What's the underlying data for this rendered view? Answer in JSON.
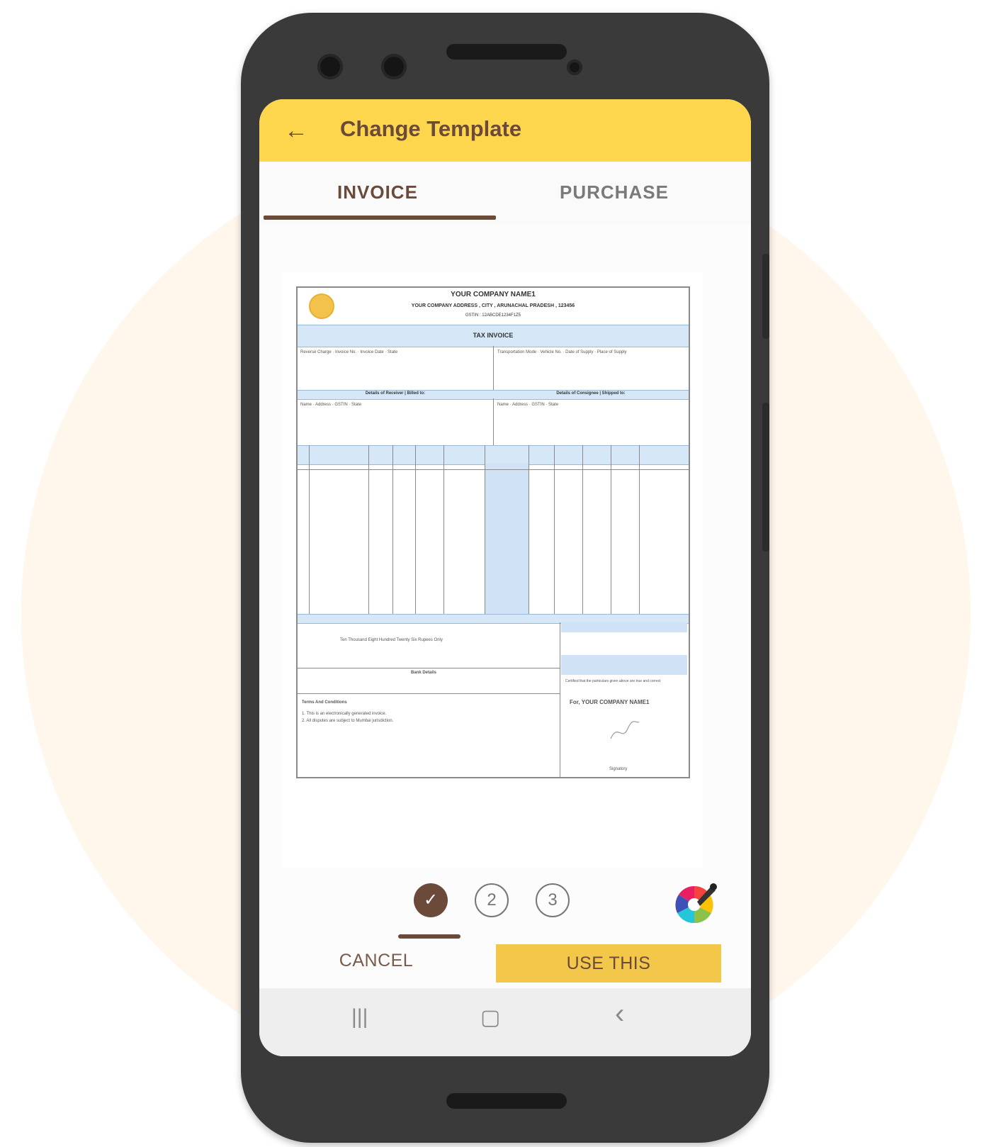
{
  "appbar": {
    "title": "Change Template",
    "back_icon": "arrow-left-icon"
  },
  "tabs": [
    {
      "label": "INVOICE",
      "selected": true
    },
    {
      "label": "PURCHASE",
      "selected": false
    }
  ],
  "template_preview": {
    "company_name": "YOUR COMPANY NAME1",
    "company_address": "YOUR COMPANY ADDRESS , CITY , ARUNACHAL PRADESH , 123456",
    "gstin": "GSTIN : 12ABCDE1234F1Z5",
    "doc_title": "TAX INVOICE",
    "section_left": "Details of Receiver | Billed to:",
    "section_right": "Details of Consignee | Shipped to:",
    "amount_words": "Ten Thousand Eight Hundred Twenty Six Rupees Only",
    "bank_title": "Bank Details",
    "terms_title": "Terms And Conditions",
    "terms": [
      "1. This is an electronically generated invoice.",
      "2. All disputes are subject to Mumbai jurisdiction."
    ],
    "certify": "Certified that the particulars given above are true and correct",
    "for_company": "For, YOUR COMPANY NAME1",
    "signatory": "Signatory"
  },
  "steps": [
    {
      "label": "✓",
      "selected": true
    },
    {
      "label": "2",
      "selected": false
    },
    {
      "label": "3",
      "selected": false
    }
  ],
  "color_picker_icon": "color-wheel-eyedropper-icon",
  "actions": {
    "cancel": "CANCEL",
    "use": "USE THIS"
  },
  "navbar": {
    "recent": "|||",
    "home": "▢",
    "back": "‹"
  },
  "colors": {
    "accent": "#fdd64d",
    "brown": "#6b4a3a",
    "button": "#f2c74a"
  }
}
